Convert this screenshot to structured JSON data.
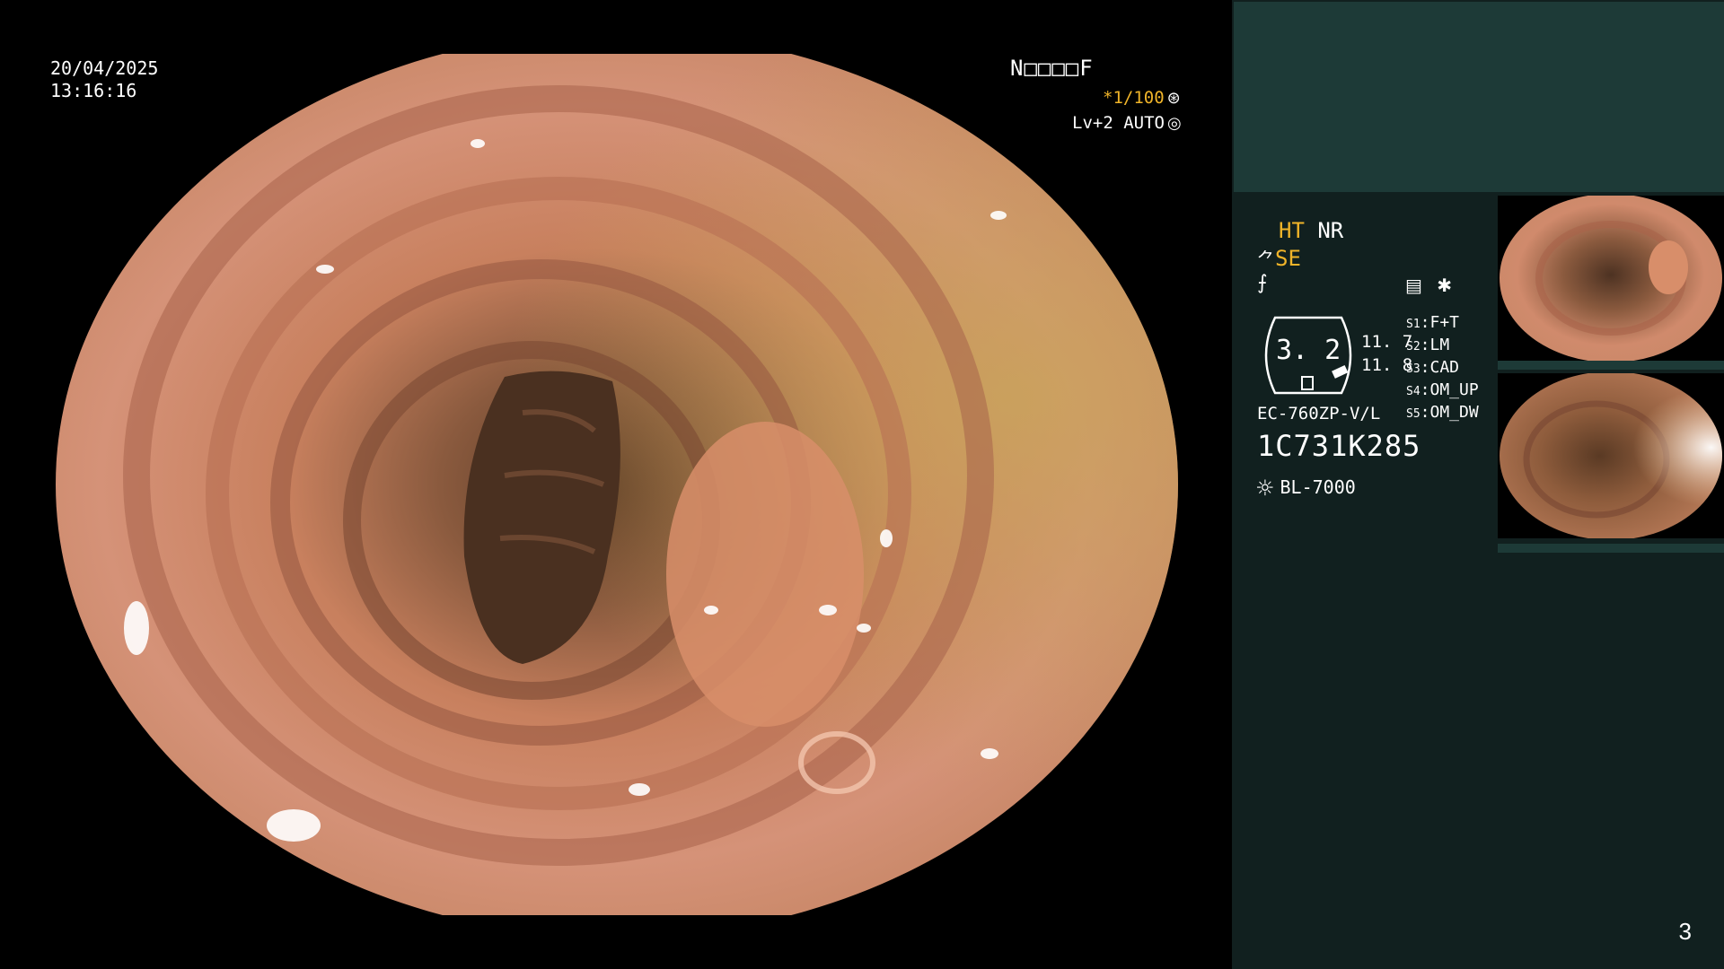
{
  "overlay": {
    "date": "20/04/2025",
    "time": "13:16:16",
    "mode_code": "N□□□□F",
    "shutter": "*1/100",
    "level": "Lv+2 AUTO"
  },
  "panel": {
    "ht": "HT",
    "nr": "NR",
    "se": "SE",
    "gauge_value": "3. 2",
    "value_a": "11. 7",
    "value_b": "11. 8",
    "slots": [
      {
        "label": "S1",
        "value": "F+T"
      },
      {
        "label": "S2",
        "value": "LM"
      },
      {
        "label": "S3",
        "value": "CAD"
      },
      {
        "label": "S4",
        "value": "OM_UP"
      },
      {
        "label": "S5",
        "value": "OM_DW"
      }
    ],
    "scope_model": "EC-760ZP-V/L",
    "scope_serial": "1C731K285",
    "light_source": "BL-7000",
    "page_number": "3"
  },
  "icons": {
    "shutter": "aperture-icon",
    "level": "auto-iris-icon",
    "se": "structure-enhance-icon",
    "filter": "filter-icon",
    "record": "record-icon",
    "light": "light-source-icon"
  },
  "colors": {
    "highlight": "#f0b429",
    "panel_bg": "#11201f",
    "panel_top_bg": "#1d3a37"
  }
}
